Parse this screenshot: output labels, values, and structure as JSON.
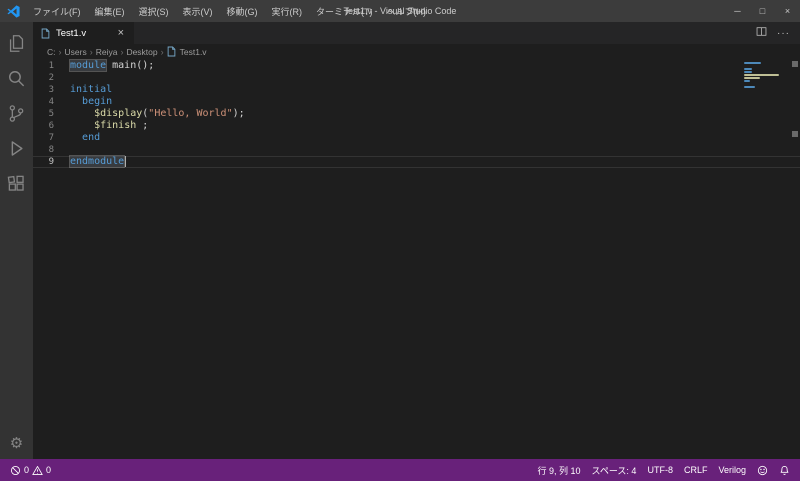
{
  "title_bar": {
    "title": "Test1.v - Visual Studio Code",
    "menus": [
      {
        "id": "file",
        "label": "ファイル(F)"
      },
      {
        "id": "edit",
        "label": "編集(E)"
      },
      {
        "id": "selection",
        "label": "選択(S)"
      },
      {
        "id": "view",
        "label": "表示(V)"
      },
      {
        "id": "go",
        "label": "移動(G)"
      },
      {
        "id": "run",
        "label": "実行(R)"
      },
      {
        "id": "terminal",
        "label": "ターミナル(T)"
      },
      {
        "id": "help",
        "label": "ヘルプ(H)"
      }
    ]
  },
  "icons": {
    "minimize": "─",
    "maximize": "□",
    "close": "×",
    "close_tab": "×",
    "more": "···",
    "separator": "›",
    "gear": "⚙",
    "names": [
      "vscode-logo-icon",
      "explorer-icon",
      "search-icon",
      "source-control-icon",
      "run-debug-icon",
      "extensions-icon",
      "gear-icon",
      "file-icon",
      "split-editor-icon",
      "more-actions-icon",
      "error-icon",
      "warning-icon",
      "feedback-icon",
      "bell-icon",
      "close-icon"
    ]
  },
  "activity_bar": {
    "items": [
      "explorer",
      "search",
      "source-control",
      "run-debug",
      "extensions"
    ],
    "bottom": [
      "manage"
    ]
  },
  "editor_tabs": {
    "active_tab": {
      "label": "Test1.v"
    }
  },
  "breadcrumb": {
    "items": [
      {
        "id": "drive-c",
        "label": "C:"
      },
      {
        "id": "users",
        "label": "Users"
      },
      {
        "id": "reiya",
        "label": "Reiya"
      },
      {
        "id": "desktop",
        "label": "Desktop"
      },
      {
        "id": "test1-v",
        "label": "Test1.v",
        "icon": true
      }
    ]
  },
  "editor": {
    "language": "verilog",
    "lines": [
      {
        "num": "1",
        "tokens": [
          {
            "text": "module",
            "color": "#569cd6",
            "highlight": true
          },
          {
            "text": " main();",
            "color": "#d4d4d4"
          }
        ]
      },
      {
        "num": "2",
        "tokens": []
      },
      {
        "num": "3",
        "tokens": [
          {
            "text": "initial",
            "color": "#569cd6"
          }
        ]
      },
      {
        "num": "4",
        "tokens": [
          {
            "text": "  "
          },
          {
            "text": "begin",
            "color": "#569cd6"
          }
        ]
      },
      {
        "num": "5",
        "tokens": [
          {
            "text": "    "
          },
          {
            "text": "$display",
            "color": "#dcdcaa"
          },
          {
            "text": "(",
            "color": "#d4d4d4"
          },
          {
            "text": "\"Hello, World\"",
            "color": "#ce9178"
          },
          {
            "text": ");",
            "color": "#d4d4d4"
          }
        ]
      },
      {
        "num": "6",
        "tokens": [
          {
            "text": "    "
          },
          {
            "text": "$finish",
            "color": "#dcdcaa"
          },
          {
            "text": " ;",
            "color": "#d4d4d4"
          }
        ]
      },
      {
        "num": "7",
        "tokens": [
          {
            "text": "  "
          },
          {
            "text": "end",
            "color": "#569cd6"
          }
        ]
      },
      {
        "num": "8",
        "tokens": []
      },
      {
        "num": "9",
        "tokens": [
          {
            "text": "endmodule",
            "color": "#569cd6",
            "highlight": true
          }
        ],
        "active": true,
        "cursor": true
      }
    ]
  },
  "status_bar": {
    "errors": "0",
    "warnings": "0",
    "cursor_position": "行 9, 列 10",
    "indentation": "スペース: 4",
    "encoding": "UTF-8",
    "eol": "CRLF",
    "language": "Verilog"
  },
  "colors": {
    "statusbar_background": "#68217A",
    "titlebar_background": "#3c3c3c",
    "activitybar_background": "#333333",
    "tabbar_background": "#252526",
    "editor_background": "#1e1e1e",
    "keyword": "#569cd6",
    "function": "#dcdcaa",
    "string": "#ce9178",
    "text": "#d4d4d4",
    "logo_blue": "#2196f3"
  }
}
